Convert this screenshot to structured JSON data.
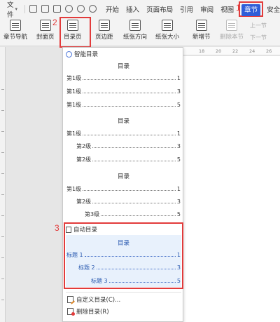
{
  "menubar": {
    "file_label": "文件",
    "tabs": [
      "开始",
      "插入",
      "页面布局",
      "引用",
      "审阅",
      "视图"
    ],
    "active_tab": "章节",
    "tab_after": "安全"
  },
  "ribbon": {
    "chapter_nav": "章节导航",
    "cover": "封面页",
    "toc_page": "目录页",
    "margins": "页边距",
    "orientation": "纸张方向",
    "paper_size": "纸张大小",
    "new_section": "新增节",
    "delete_section": "删除本节",
    "prev_section": "上一节",
    "next_section": "下一节"
  },
  "annotations": {
    "n1": "1",
    "n2": "2",
    "n3": "3"
  },
  "ruler": [
    "18",
    "20",
    "22",
    "24",
    "26"
  ],
  "dropdown": {
    "smart_header": "智能目录",
    "toc1": {
      "title": "目录",
      "rows": [
        {
          "label": "第1级",
          "page": "1"
        },
        {
          "label": "第1级",
          "page": "3"
        },
        {
          "label": "第1级",
          "page": "5"
        }
      ]
    },
    "toc2": {
      "title": "目录",
      "rows": [
        {
          "label": "第1级",
          "page": "1"
        },
        {
          "label": "第2级",
          "page": "3"
        },
        {
          "label": "第2级",
          "page": "5"
        }
      ]
    },
    "toc3": {
      "title": "目录",
      "rows": [
        {
          "label": "第1级",
          "page": "1"
        },
        {
          "label": "第2级",
          "page": "3"
        },
        {
          "label": "第3级",
          "page": "5"
        }
      ]
    },
    "auto_header": "自动目录",
    "auto": {
      "title": "目录",
      "rows": [
        {
          "label": "标题 1",
          "page": "1"
        },
        {
          "label": "标题 2",
          "page": "3"
        },
        {
          "label": "标题 3",
          "page": "5"
        }
      ]
    },
    "custom_toc": "自定义目录(C)...",
    "delete_toc": "删除目录(R)"
  }
}
